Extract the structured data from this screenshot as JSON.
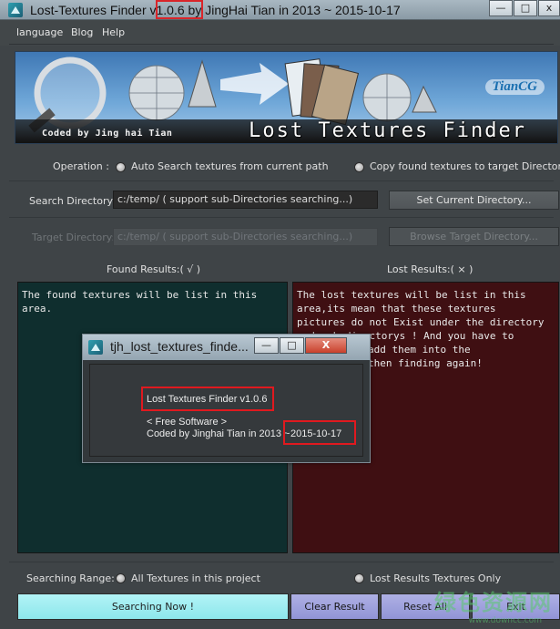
{
  "window": {
    "title_prefix": "Lost-Textures Finder ",
    "title_version": "v1.0.6",
    "title_suffix": " by JingHai Tian in 2013 ~ 2015-10-17",
    "controls": {
      "minimize": "—",
      "maximize": "□",
      "close": "x"
    }
  },
  "menu": {
    "items": [
      "language",
      "Blog",
      "Help"
    ]
  },
  "banner": {
    "credit": "Coded by Jing hai Tian",
    "title": "Lost Textures Finder",
    "logo": "TianCG"
  },
  "operation": {
    "label": "Operation :",
    "option_auto": "Auto Search textures from current path",
    "option_copy": "Copy found textures to target Directory"
  },
  "search_dir": {
    "label": "Search Directory:",
    "value": "c:/temp/ ( support sub-Directories searching...)",
    "button": "Set Current Directory..."
  },
  "target_dir": {
    "label": "Target Directory:",
    "value": "c:/temp/ ( support sub-Directories searching...)",
    "button": "Browse Target Directory..."
  },
  "results": {
    "found_header": "Found Results:( √ )",
    "lost_header": "Lost Results:( × )",
    "found_lines": [
      "The found textures will be list in this",
      "area."
    ],
    "lost_lines": [
      "The lost textures will be list in this",
      "area,its mean that these textures",
      "pictures do not Exist under the directory",
      "and sub-directorys ! And you have to",
      "add them into the",
      "then finding again!"
    ]
  },
  "about_dialog": {
    "title": "tjh_lost_textures_finde...",
    "controls": {
      "minimize": "—",
      "maximize": "□",
      "close": "X"
    },
    "product": "Lost Textures Finder   v1.0.6",
    "license": "< Free Software >",
    "credit": "Coded by Jinghai Tian in 2013 ~",
    "date": "2015-10-17"
  },
  "searching_range": {
    "label": "Searching Range:",
    "option_all": "All Textures in this project",
    "option_lost": "Lost Results Textures Only"
  },
  "buttons": {
    "search": "Searching  Now !",
    "clear": "Clear Result",
    "reset": "Reset All",
    "exit": "Exit"
  },
  "watermark": {
    "text": "绿色资源网",
    "sub": "www.downcc.com"
  },
  "colors": {
    "highlight": "#e0191f",
    "found_bg": "#0f2e2e",
    "lost_bg": "#3f0f12",
    "search_btn": "#8de7ec",
    "action_btn": "#9194d6"
  }
}
